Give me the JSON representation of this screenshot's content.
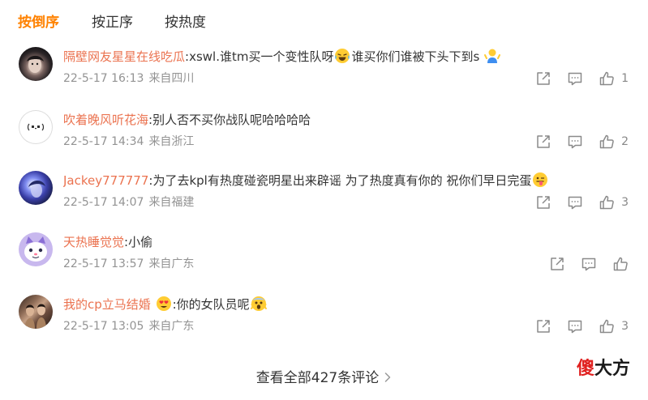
{
  "tabs": [
    {
      "label": "按倒序",
      "active": true
    },
    {
      "label": "按正序",
      "active": false
    },
    {
      "label": "按热度",
      "active": false
    }
  ],
  "comments": [
    {
      "username": "隔壁网友星星在线吃瓜",
      "parts": [
        ":xswl.谁tm买一个变性队呀",
        "谁买你们谁被下头下到s"
      ],
      "emojis": [
        "laughing-tears-emoji",
        "shrug-emoji"
      ],
      "time": "22-5-17 16:13",
      "location": "来自四川",
      "likes": "1"
    },
    {
      "username": "吹着晚风听花海",
      "parts": [
        ":别人否不买你战队呢哈哈哈哈"
      ],
      "emojis": [],
      "time": "22-5-17 14:34",
      "location": "来自浙江",
      "likes": "2"
    },
    {
      "username": "Jackey777777",
      "parts": [
        ":为了去kpl有热度碰瓷明星出来辟谣 为了热度真有你的 祝你们早日完蛋"
      ],
      "emojis": [
        "tongue-wink-emoji"
      ],
      "time": "22-5-17 14:07",
      "location": "来自福建",
      "likes": "3"
    },
    {
      "username": "天热睡觉觉",
      "parts": [
        ":小偷"
      ],
      "emojis": [],
      "time": "22-5-17 13:57",
      "location": "来自广东",
      "likes": null
    },
    {
      "username": "我的cp立马结婚",
      "parts": [
        ":你的女队员呢"
      ],
      "emojis": [
        "heart-face-emoji",
        "scared-face-emoji"
      ],
      "time": "22-5-17 13:05",
      "location": "来自广东",
      "likes": "3"
    }
  ],
  "footer": {
    "more_comments": "查看全部427条评论"
  },
  "watermark": {
    "red": "傻",
    "dark": "大方"
  },
  "icons": {
    "share": "share-icon",
    "comment": "comment-icon",
    "like": "thumbs-up-icon",
    "more": "chevron-right-icon"
  },
  "colors": {
    "accent": "#ff8200",
    "username": "#eb7350",
    "text": "#333333",
    "meta": "#939393",
    "icon": "#8a8a8a",
    "watermark_red": "#e0201f"
  }
}
